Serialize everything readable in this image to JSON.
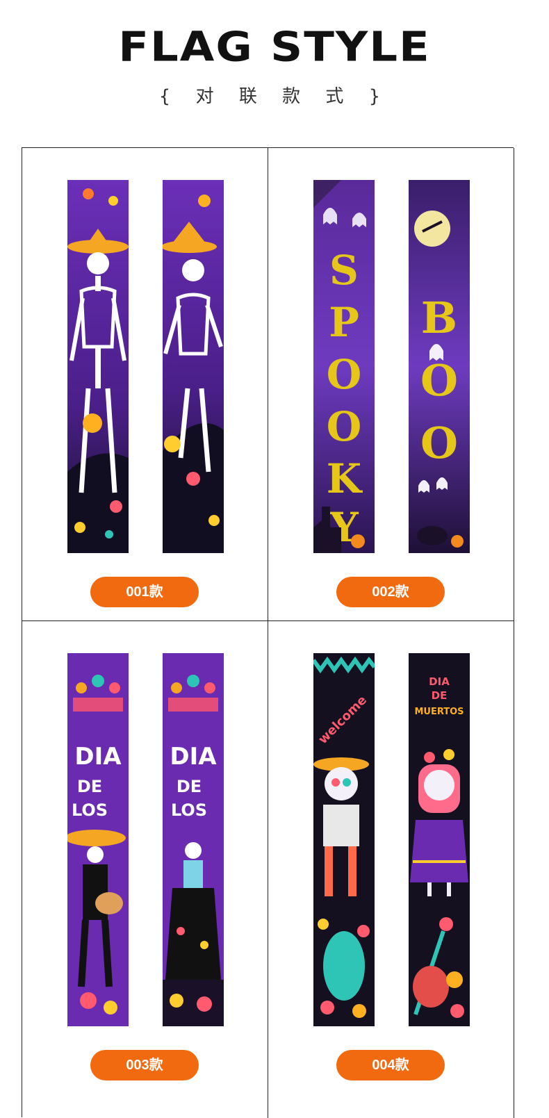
{
  "header": {
    "title": "FLAG STYLE",
    "subtitle": "{ 对 联 款 式 }"
  },
  "styles": [
    {
      "label": "001款",
      "left_text": "",
      "right_text": ""
    },
    {
      "label": "002款",
      "left_text": "SPOOKY",
      "right_text": "BOO"
    },
    {
      "label": "003款",
      "left_text": "DIA DE LOS",
      "right_text": "DIA DE LOS"
    },
    {
      "label": "004款",
      "left_text": "welcome",
      "right_text": "DIA DE MUERTOS"
    }
  ],
  "colors": {
    "accent": "#f26a10",
    "purple": "#6a2bb0",
    "dark": "#141020"
  }
}
